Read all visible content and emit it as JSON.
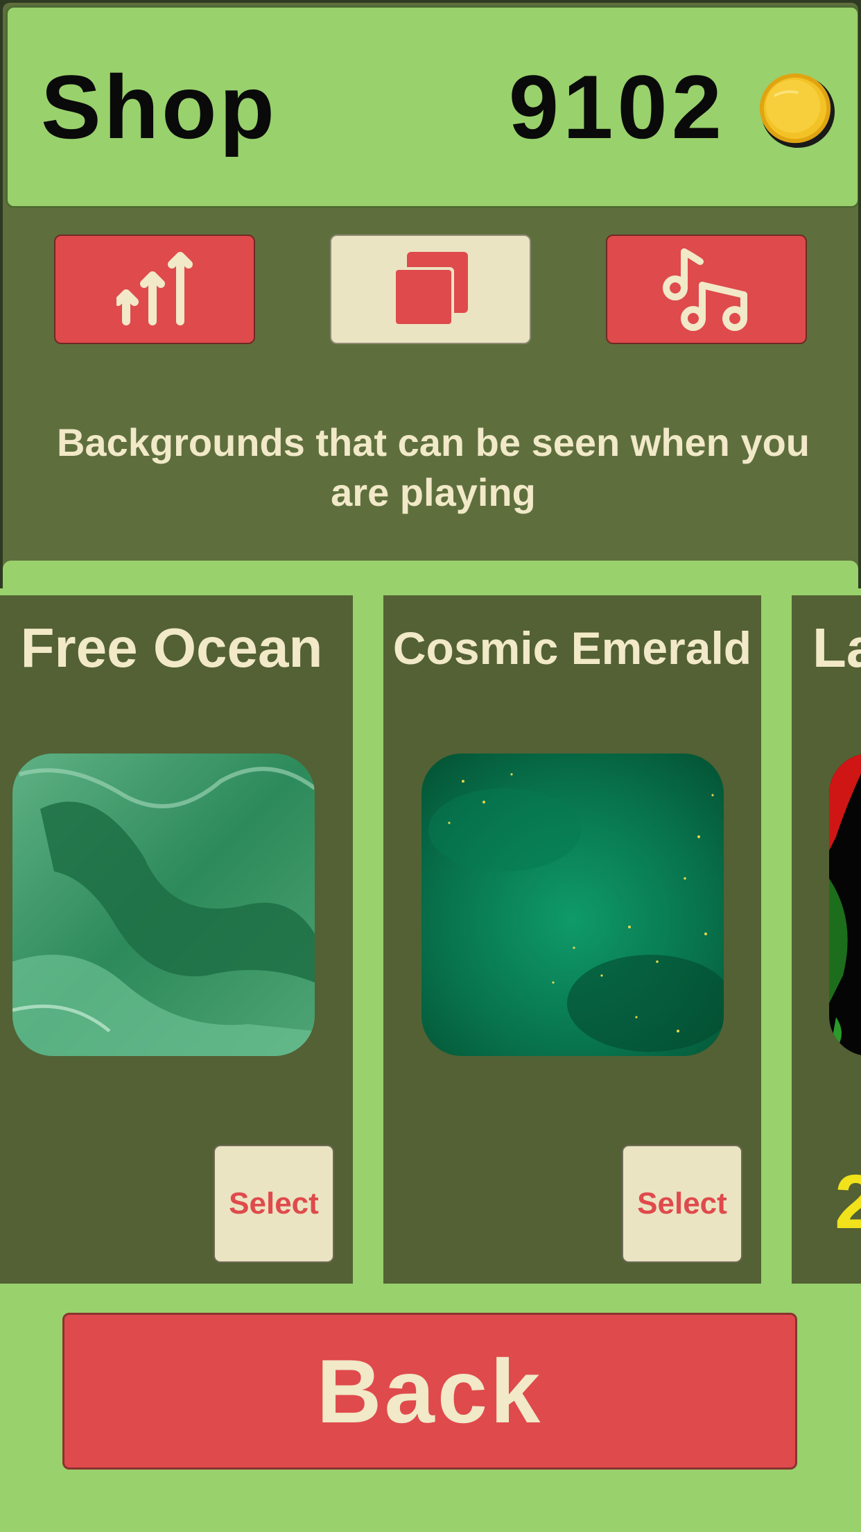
{
  "header": {
    "title": "Shop",
    "coin_count": "9102",
    "coin_icon": "gold-coin-icon"
  },
  "tabs": [
    {
      "name": "upgrades",
      "icon": "upgrade-arrows-icon",
      "active": false
    },
    {
      "name": "backgrounds",
      "icon": "layers-icon",
      "active": true
    },
    {
      "name": "music",
      "icon": "music-notes-icon",
      "active": false
    }
  ],
  "description": "Backgrounds that can be seen when you are playing",
  "items": [
    {
      "title": "Free Ocean",
      "button": "Select",
      "image": "green marble texture"
    },
    {
      "title": "Cosmic Emerald",
      "button": "Select",
      "image": "emerald space nebula"
    },
    {
      "title": "La",
      "price_peek": "2",
      "image": "red and black abstract"
    }
  ],
  "colors": {
    "header_green": "#99d16c",
    "panel_olive": "#5e6f3d",
    "card_olive": "#536134",
    "accent_red": "#df4a4c",
    "cream": "#ebe4c3",
    "text_cream": "#f1e9c8",
    "price_yellow": "#f1e21b"
  },
  "back_button": "Back"
}
